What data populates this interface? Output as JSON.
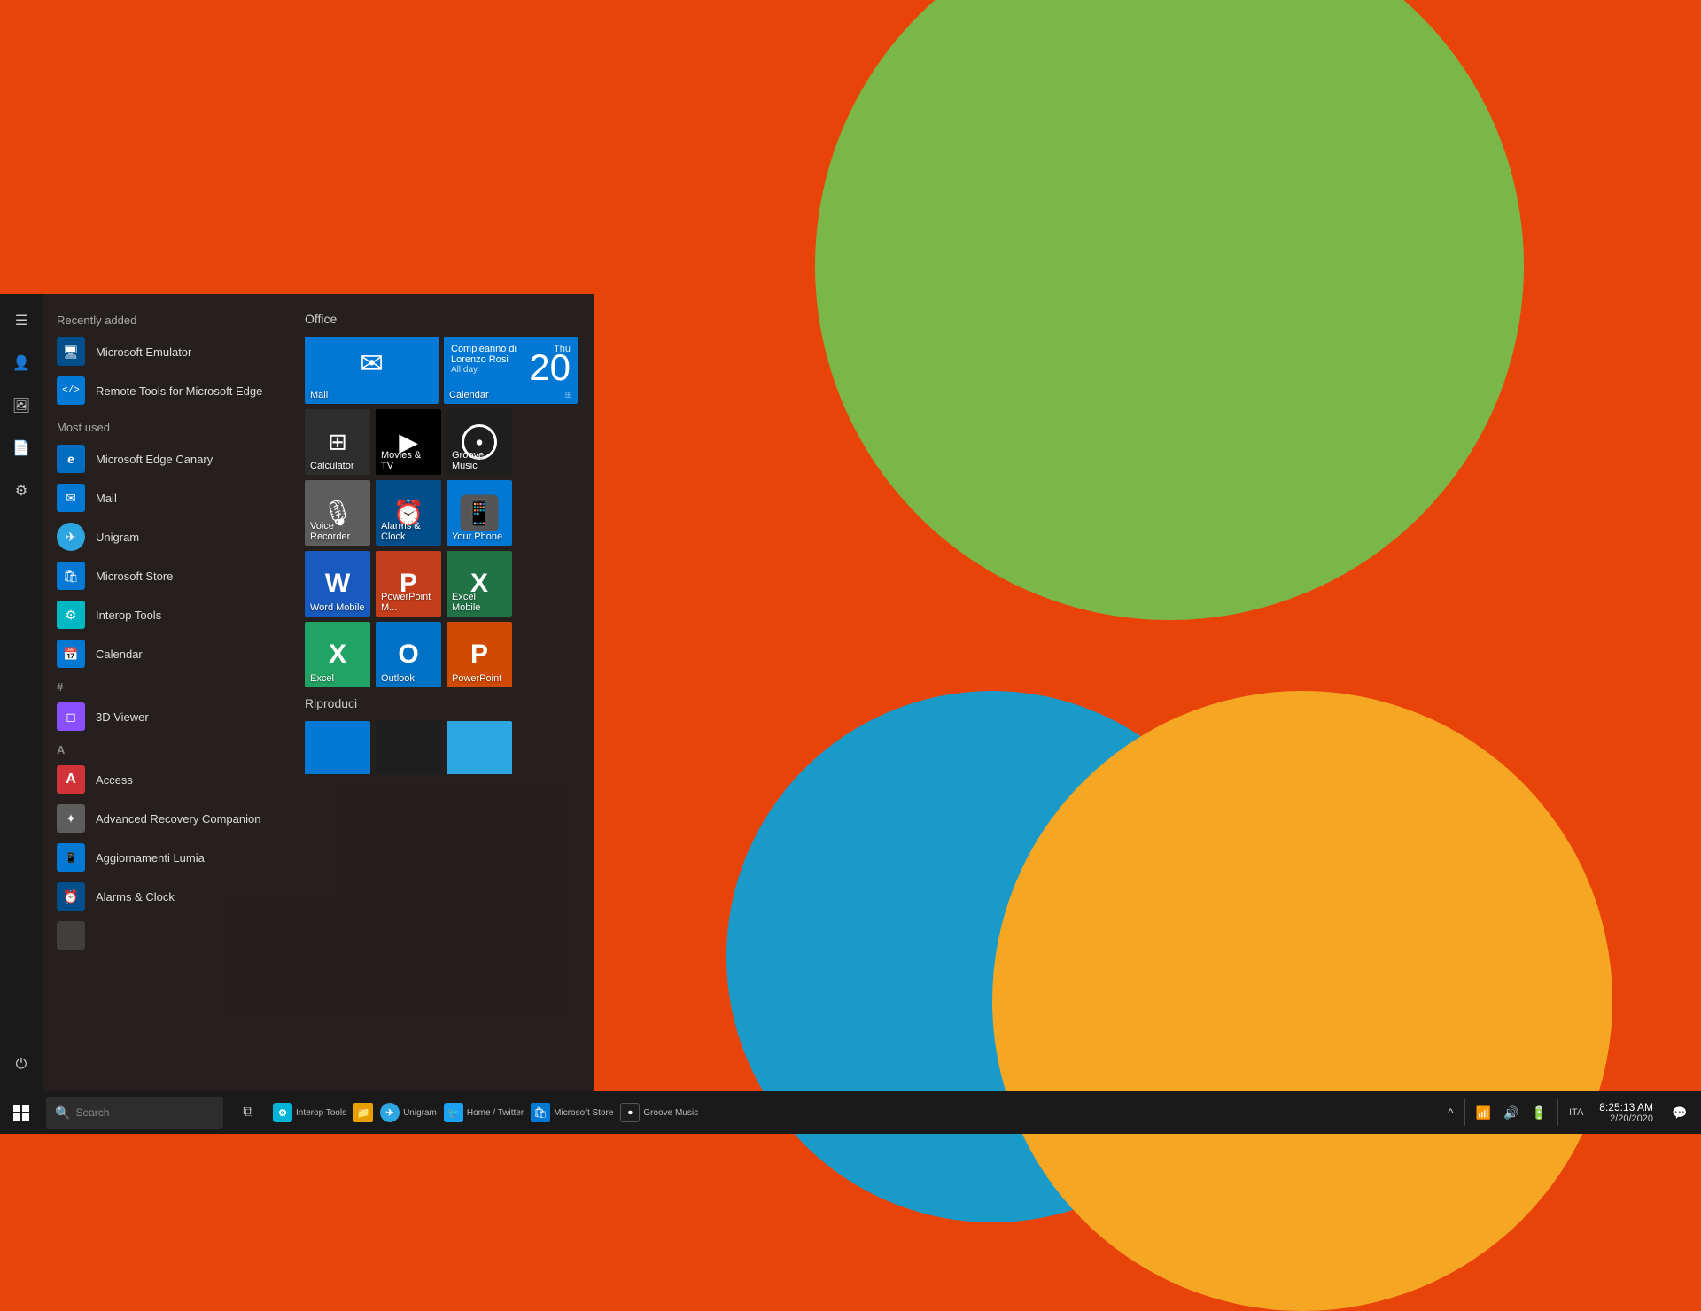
{
  "wallpaper": {
    "bg_color": "#e8440a"
  },
  "start_menu": {
    "sidebar": {
      "icons": [
        "☰",
        "👤",
        "🖼",
        "📄",
        "⚙",
        "⏻"
      ]
    },
    "recently_added_header": "Recently added",
    "recently_added": [
      {
        "name": "Microsoft Emulator",
        "icon": "🖥",
        "color": "#004e8c"
      },
      {
        "name": "Remote Tools for Microsoft Edge",
        "icon": "</>",
        "color": "#0078d4"
      }
    ],
    "most_used_header": "Most used",
    "most_used": [
      {
        "name": "Microsoft Edge Canary",
        "icon": "e",
        "color": "#006dc0"
      },
      {
        "name": "Mail",
        "icon": "✉",
        "color": "#0078d4"
      },
      {
        "name": "Unigram",
        "icon": "✈",
        "color": "#2ca5e0"
      },
      {
        "name": "Microsoft Store",
        "icon": "🛍",
        "color": "#0078d4"
      },
      {
        "name": "Interop Tools",
        "icon": "⚙",
        "color": "#00b4d8"
      },
      {
        "name": "Calendar",
        "icon": "📅",
        "color": "#0078d4"
      }
    ],
    "alpha_sections": [
      {
        "letter": "#",
        "apps": [
          {
            "name": "3D Viewer",
            "icon": "◻",
            "color": "#8a4fff"
          }
        ]
      },
      {
        "letter": "A",
        "apps": [
          {
            "name": "Access",
            "icon": "A",
            "color": "#b7472a"
          },
          {
            "name": "Advanced Recovery Companion",
            "icon": "✦",
            "color": "#5d5d5d"
          },
          {
            "name": "Aggiornamenti Lumia",
            "icon": "📱",
            "color": "#0078d4"
          },
          {
            "name": "Alarms & Clock",
            "icon": "⏰",
            "color": "#004e8c"
          }
        ]
      }
    ],
    "tiles": {
      "office_header": "Office",
      "office_tiles": [
        {
          "id": "mail",
          "name": "Mail",
          "size": "wide",
          "bg": "#0078d4",
          "icon": "✉"
        },
        {
          "id": "calendar",
          "name": "Calendar",
          "size": "wide",
          "bg": "#0078d4",
          "event": "Compleanno di Lorenzo Rosi",
          "allday": "All day",
          "day": "Thu",
          "date": "20"
        },
        {
          "id": "calculator",
          "name": "Calculator",
          "size": "medium",
          "bg": "#2d2d2d",
          "icon": "⊞"
        },
        {
          "id": "movies",
          "name": "Movies & TV",
          "size": "medium",
          "bg": "#1a1a1a",
          "icon": "▶"
        },
        {
          "id": "groove",
          "name": "Groove Music",
          "size": "medium",
          "bg": "#1e1e1e",
          "icon": "⏺"
        },
        {
          "id": "voice",
          "name": "Voice Recorder",
          "size": "medium",
          "bg": "#5d5d5d",
          "icon": "🎙"
        },
        {
          "id": "alarms",
          "name": "Alarms & Clock",
          "size": "medium",
          "bg": "#004e8c",
          "icon": "⏰"
        },
        {
          "id": "phone",
          "name": "Your Phone",
          "size": "medium",
          "bg": "#0078d4",
          "icon": "📱"
        },
        {
          "id": "word",
          "name": "Word Mobile",
          "size": "medium",
          "bg": "#185abd",
          "icon": "W"
        },
        {
          "id": "pptm",
          "name": "PowerPoint M...",
          "size": "medium",
          "bg": "#c43e1c",
          "icon": "P"
        },
        {
          "id": "excelm",
          "name": "Excel Mobile",
          "size": "medium",
          "bg": "#217346",
          "icon": "X"
        },
        {
          "id": "excel",
          "name": "Excel",
          "size": "medium",
          "bg": "#21a366",
          "icon": "X"
        },
        {
          "id": "outlook",
          "name": "Outlook",
          "size": "medium",
          "bg": "#0072c6",
          "icon": "O"
        },
        {
          "id": "ppt",
          "name": "PowerPoint",
          "size": "medium",
          "bg": "#d04a02",
          "icon": "P"
        }
      ],
      "riproduci_header": "Riproduci",
      "riproduci_tiles": [
        {
          "id": "r1",
          "name": "",
          "size": "medium",
          "bg": "#0078d4",
          "icon": ""
        },
        {
          "id": "r2",
          "name": "",
          "size": "medium",
          "bg": "#1e1e1e",
          "icon": ""
        },
        {
          "id": "r3",
          "name": "",
          "size": "medium",
          "bg": "#2ca5e0",
          "icon": ""
        }
      ]
    }
  },
  "taskbar": {
    "start_icon": "⊞",
    "search_placeholder": "Search",
    "pinned_apps": [
      {
        "id": "interop",
        "label": "Interop Tools",
        "color": "#00b4d8"
      },
      {
        "id": "files",
        "label": "File Explorer",
        "color": "#e8a000"
      },
      {
        "id": "telegram",
        "label": "Unigram",
        "color": "#2ca5e0"
      },
      {
        "id": "twitter",
        "label": "Home / Twitter",
        "color": "#1da1f2"
      },
      {
        "id": "store",
        "label": "Microsoft Store",
        "color": "#0078d4"
      },
      {
        "id": "groove",
        "label": "Groove Music",
        "color": "#1e1e1e"
      }
    ],
    "systray": {
      "icons": [
        "🔧",
        "^",
        "🔊",
        "📶"
      ],
      "lang": "ITA",
      "time": "8:25:13 AM",
      "date": "2/20/2020",
      "action_center": "🔔"
    }
  }
}
